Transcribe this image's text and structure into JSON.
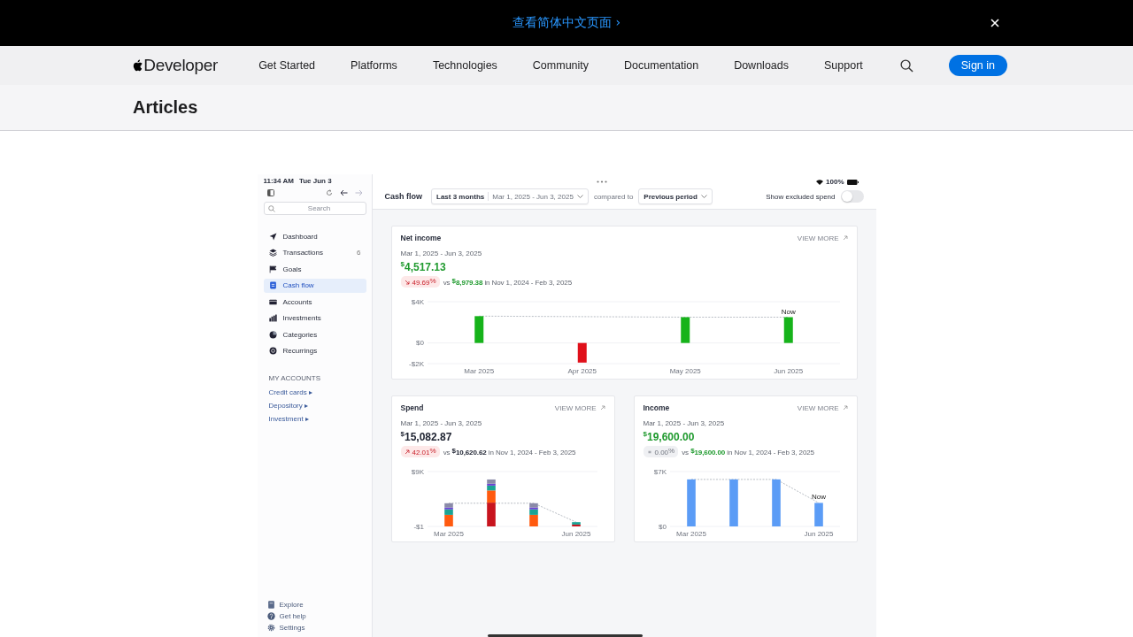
{
  "banner": {
    "text": "查看简体中文页面 ›"
  },
  "nav": {
    "logo": "Developer",
    "items": [
      "Get Started",
      "Platforms",
      "Technologies",
      "Community",
      "Documentation",
      "Downloads",
      "Support"
    ],
    "sign_in": "Sign in"
  },
  "page_title": "Articles",
  "app": {
    "status": {
      "time": "11:34 AM",
      "date": "Tue Jun 3",
      "battery": "100%"
    },
    "search": {
      "placeholder": "Search"
    },
    "sidebar": {
      "items": [
        {
          "label": "Dashboard",
          "kind": "navigate",
          "selected": false
        },
        {
          "label": "Transactions",
          "kind": "layers",
          "count": "6",
          "selected": false
        },
        {
          "label": "Goals",
          "kind": "flag",
          "selected": false
        },
        {
          "label": "Cash flow",
          "kind": "doc",
          "selected": true
        },
        {
          "label": "Accounts",
          "kind": "card",
          "selected": false
        },
        {
          "label": "Investments",
          "kind": "bars",
          "selected": false
        },
        {
          "label": "Categories",
          "kind": "pie",
          "selected": false
        },
        {
          "label": "Recurrings",
          "kind": "cycle",
          "selected": false
        }
      ],
      "section": "MY ACCOUNTS",
      "accounts": [
        "Credit cards ▸",
        "Depository ▸",
        "Investment ▸"
      ],
      "footer": [
        {
          "label": "Explore",
          "kind": "book"
        },
        {
          "label": "Get help",
          "kind": "help"
        },
        {
          "label": "Settings",
          "kind": "gear"
        }
      ]
    },
    "toolbar": {
      "title": "Cash flow",
      "range": "Last 3 months",
      "dates": "Mar 1, 2025 - Jun 3, 2025",
      "compared": "compared to",
      "period": "Previous period",
      "toggle_label": "Show excluded spend",
      "toggle_on": false
    },
    "cards": [
      {
        "title": "Net income",
        "kind": "gain",
        "view_more": "VIEW MORE",
        "dates": "Mar 1, 2025 - Jun 3, 2025",
        "amount": "$^{$}$4,517.13",
        "badge": {
          "kind": "down",
          "text": "49.69$^{%}$"
        },
        "vs": "vs",
        "prev": "$^{$}$8,979.38",
        "period": "in Nov 1, 2024 - Feb 3, 2025",
        "chart_data": {
          "type": "bar",
          "categories": [
            "Mar 2025",
            "Apr 2025",
            "May 2025",
            "Jun 2025"
          ],
          "ylim": [
            -2000,
            4000
          ],
          "yticks": [
            {
              "value": 4000,
              "label": "$4K"
            },
            {
              "value": 0,
              "label": "$0"
            },
            {
              "value": -2000,
              "label": "-$2K"
            }
          ],
          "series": [
            {
              "color": "#16b31a",
              "values": [
                2600,
                null,
                2500,
                2500
              ]
            },
            {
              "color": "#e0101a",
              "values": [
                null,
                -1900,
                null,
                null
              ]
            }
          ],
          "annotations": [
            "Now"
          ]
        }
      },
      {
        "title": "Spend",
        "kind": "cost",
        "view_more": "VIEW MORE",
        "dates": "Mar 1, 2025 - Jun 3, 2025",
        "amount": "$^{$}$15,082.87",
        "badge": {
          "kind": "up",
          "text": "42.01$^{%}$"
        },
        "vs": "vs",
        "prev": "$^{$}$10,620.62",
        "period": "in Nov 1, 2024 - Feb 3, 2025",
        "chart_data": {
          "type": "bar",
          "stacked": true,
          "categories": [
            "Mar 2025",
            null,
            null,
            "Jun 2025"
          ],
          "ylim": [
            -1,
            9000
          ],
          "yticks": [
            {
              "value": 9000,
              "label": "$9K"
            },
            {
              "value": -1,
              "label": "-$1"
            }
          ],
          "series": [
            {
              "color": "#c8141e",
              "values": [
                0,
                3900,
                0,
                300
              ]
            },
            {
              "color": "#ff5a0f",
              "values": [
                1900,
                2000,
                1900,
                0
              ]
            },
            {
              "color": "#1aa394",
              "values": [
                900,
                800,
                900,
                400
              ]
            },
            {
              "color": "#6a3fd4",
              "values": [
                300,
                300,
                300,
                0
              ]
            },
            {
              "color": "#8a8aa8",
              "values": [
                700,
                700,
                700,
                0
              ]
            }
          ]
        }
      },
      {
        "title": "Income",
        "kind": "gain",
        "view_more": "VIEW MORE",
        "dates": "Mar 1, 2025 - Jun 3, 2025",
        "amount": "$^{$}$19,600.00",
        "badge": {
          "kind": "flat",
          "text": "0.00$^{%}$"
        },
        "vs": "vs",
        "prev": "$^{$}$19,600.00",
        "period": "in Nov 1, 2024 - Feb 3, 2025",
        "chart_data": {
          "type": "bar",
          "categories": [
            "Mar 2025",
            null,
            null,
            "Jun 2025"
          ],
          "ylim": [
            0,
            7000
          ],
          "yticks": [
            {
              "value": 7000,
              "label": "$7K"
            },
            {
              "value": 0,
              "label": "$0"
            }
          ],
          "series": [
            {
              "color": "#5b9cf6",
              "values": [
                6000,
                6000,
                6000,
                3000
              ]
            }
          ],
          "annotations": [
            "Now"
          ]
        }
      }
    ]
  }
}
